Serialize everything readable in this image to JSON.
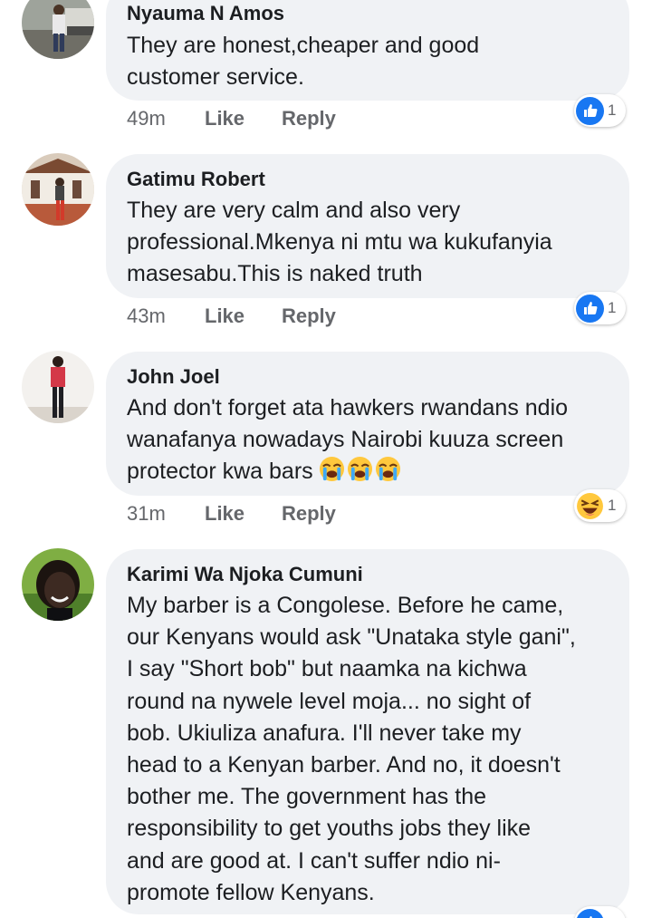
{
  "comments": [
    {
      "author": "Nyauma N Amos",
      "text": "They are honest,cheaper and good\ncustomer service.",
      "time": "49m",
      "like_label": "Like",
      "reply_label": "Reply",
      "reaction": {
        "icon": "thumbs-up-icon",
        "count": "1"
      }
    },
    {
      "author": "Gatimu Robert",
      "text": "They are very calm and also very\nprofessional.Mkenya ni mtu wa kukufanyia\nmasesabu.This is naked truth",
      "time": "43m",
      "like_label": "Like",
      "reply_label": "Reply",
      "reaction": {
        "icon": "thumbs-up-icon",
        "count": "1"
      }
    },
    {
      "author": "John Joel",
      "text": "And don't forget ata hawkers rwandans ndio\nwanafanya nowadays Nairobi kuuza screen\nprotector kwa bars",
      "emoji": [
        "loudly-crying-face-icon",
        "loudly-crying-face-icon",
        "loudly-crying-face-icon"
      ],
      "time": "31m",
      "like_label": "Like",
      "reply_label": "Reply",
      "reaction": {
        "icon": "laughing-face-icon",
        "count": "1"
      }
    },
    {
      "author": "Karimi Wa Njoka Cumuni",
      "text": "My barber is a Congolese. Before he came,\nour Kenyans would ask \"Unataka style gani\",\nI say \"Short bob\" but naamka na kichwa\nround na nywele level moja... no sight of\nbob. Ukiuliza anafura. I'll never take my\nhead to a Kenyan barber. And no, it doesn't\nbother me. The government has the\nresponsibility to get youths jobs they like\nand are good at. I can't suffer ndio ni-\npromote fellow Kenyans."
    }
  ],
  "colors": {
    "bubble": "#f0f2f5",
    "meta_text": "#65676b",
    "body_text": "#1c1e21",
    "like_blue": "#1877f2",
    "emoji_yellow": "#ffc83d"
  }
}
